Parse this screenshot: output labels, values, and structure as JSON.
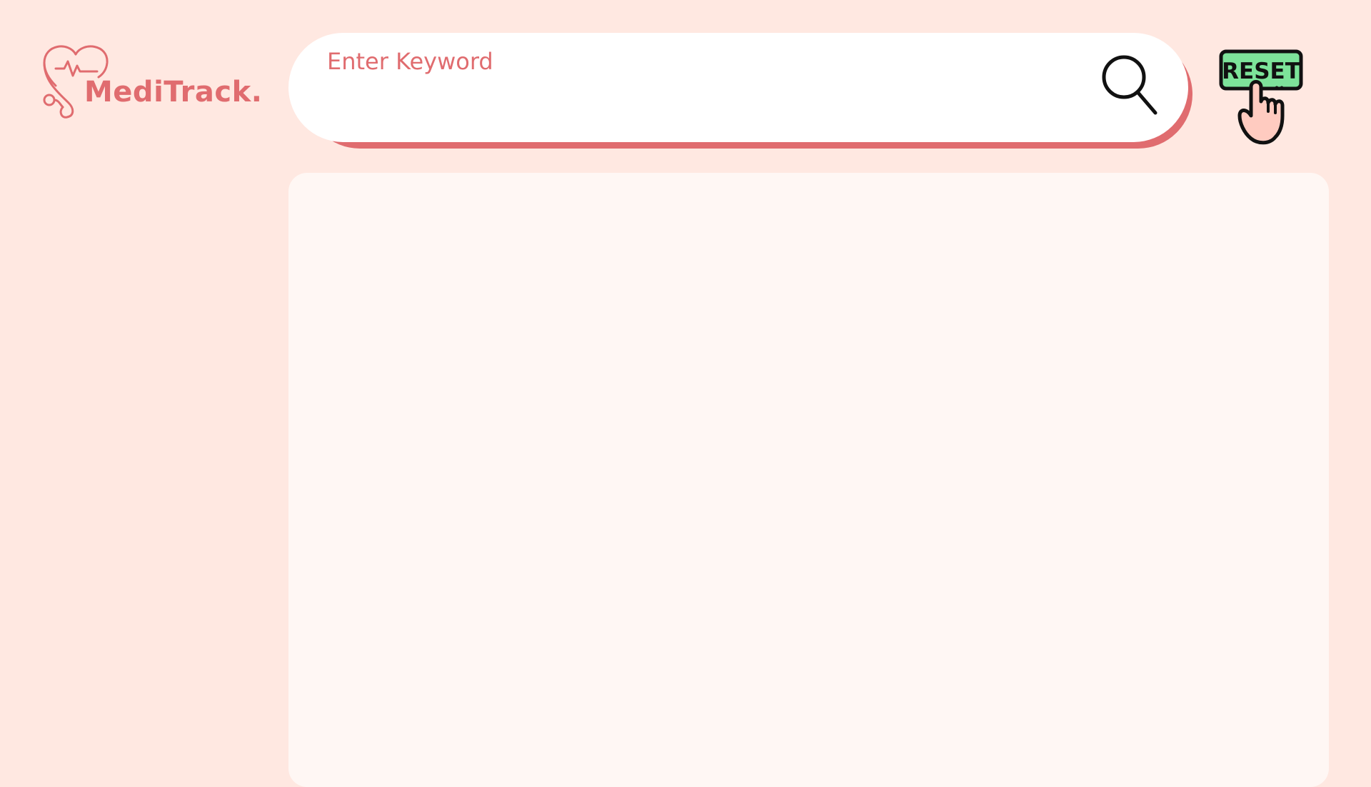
{
  "app": {
    "name": "MediTrack."
  },
  "logo": {
    "icon": "heart-stethoscope-icon"
  },
  "search": {
    "placeholder": "Enter Keyword",
    "value": "",
    "icon": "search-icon"
  },
  "reset": {
    "label": "RESET",
    "icon": "hand-pointer-icon"
  },
  "colors": {
    "background": "#FFE8E1",
    "brand": "#E06C6F",
    "panel": "#FFF7F4",
    "search_bg": "#FFFFFF",
    "reset_green": "#7DE39A",
    "hand": "#FFCBC0",
    "outline": "#111111"
  }
}
